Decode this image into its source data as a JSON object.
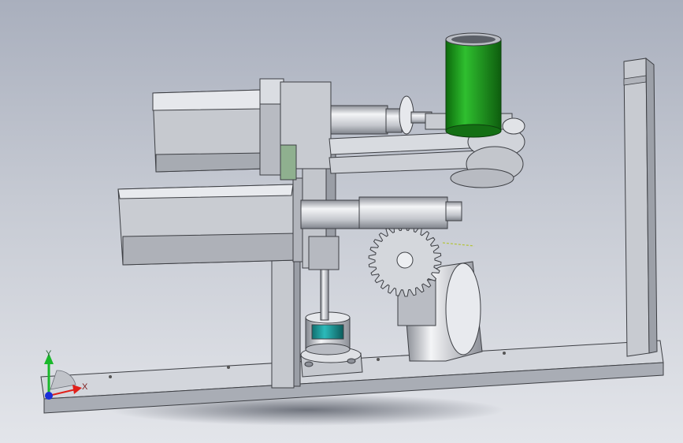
{
  "view": {
    "background_top": "#a9afbd",
    "background_bottom": "#e3e5ea"
  },
  "triad": {
    "x_label": "X",
    "y_label": "Y",
    "x_color": "#e0201a",
    "y_color": "#19b82a",
    "z_color": "#1a2fd8"
  },
  "parts": {
    "metal_color": "#c9ccd2",
    "tube_color": "#1f9a1f",
    "bushing_color": "#1c9c9c"
  }
}
